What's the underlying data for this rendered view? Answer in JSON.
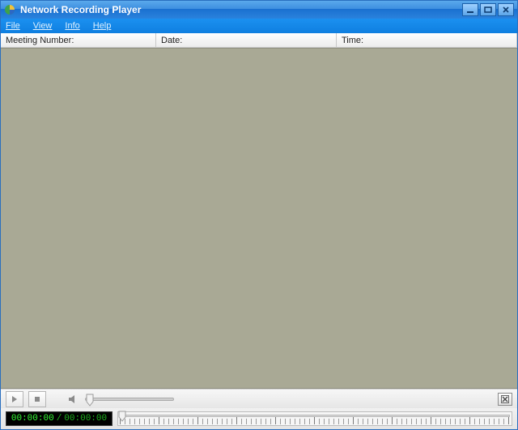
{
  "window": {
    "title": "Network Recording Player"
  },
  "menu": {
    "file": "File",
    "view": "View",
    "info": "Info",
    "help": "Help"
  },
  "columns": {
    "meeting_label": "Meeting Number:",
    "meeting_value": "",
    "date_label": "Date:",
    "date_value": "",
    "time_label": "Time:",
    "time_value": ""
  },
  "playback": {
    "current_time": "00:00:00",
    "total_time": "00:00:00",
    "separator": "/",
    "volume_percent": 0,
    "seek_percent": 0
  },
  "colors": {
    "titlebar_top": "#5aa9ec",
    "titlebar_bottom": "#2a82dc",
    "menubar": "#0f7fe0",
    "content_bg": "#a9a995",
    "time_current": "#36ff36",
    "time_total": "#1fb51f"
  }
}
